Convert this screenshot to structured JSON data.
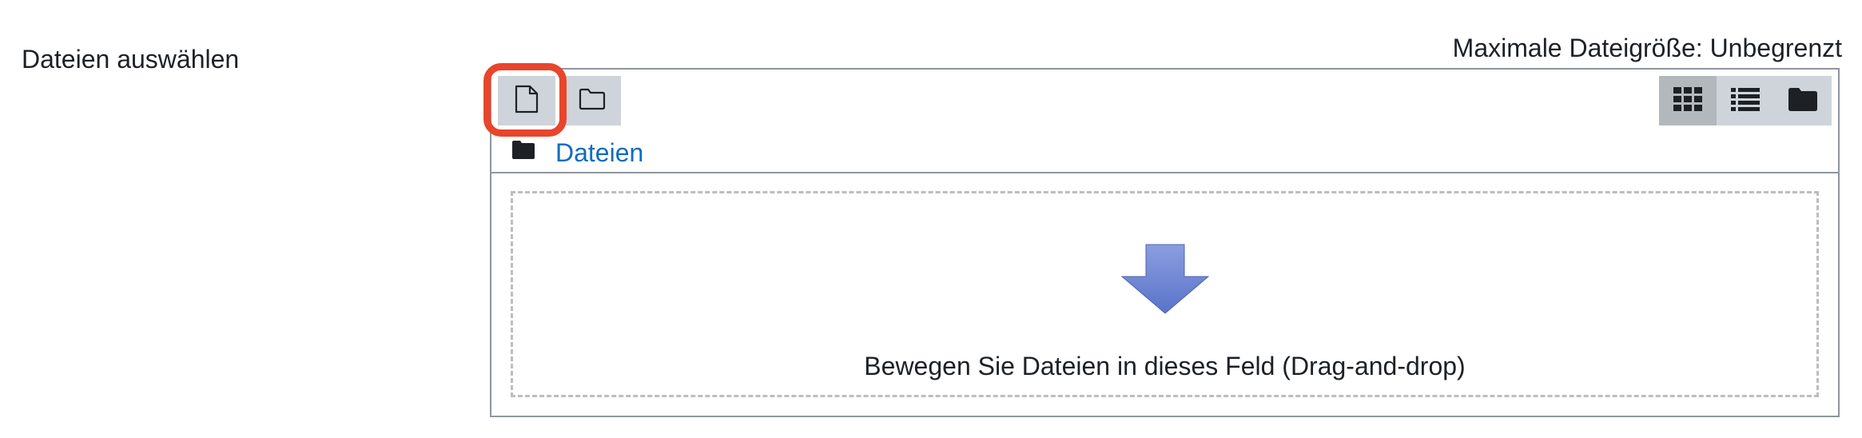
{
  "form": {
    "label": "Dateien auswählen",
    "max_size": "Maximale Dateigröße: Unbegrenzt"
  },
  "toolbar": {
    "add_icon": "file-icon",
    "mkdir_icon": "folder-outline-icon",
    "views": [
      {
        "icon": "grid-icon",
        "active": true
      },
      {
        "icon": "list-icon",
        "active": false
      },
      {
        "icon": "folder-icon",
        "active": false
      }
    ]
  },
  "path": {
    "folder_icon": "folder-icon",
    "label": "Dateien"
  },
  "dropzone": {
    "icon": "arrow-down-icon",
    "text": "Bewegen Sie Dateien in dieses Feld (Drag-and-drop)"
  },
  "colors": {
    "highlight": "#e8452c",
    "link": "#0f6cbf",
    "button_bg": "#ced4da",
    "button_active_bg": "#b3b8bd",
    "arrow": "#7088d6"
  }
}
